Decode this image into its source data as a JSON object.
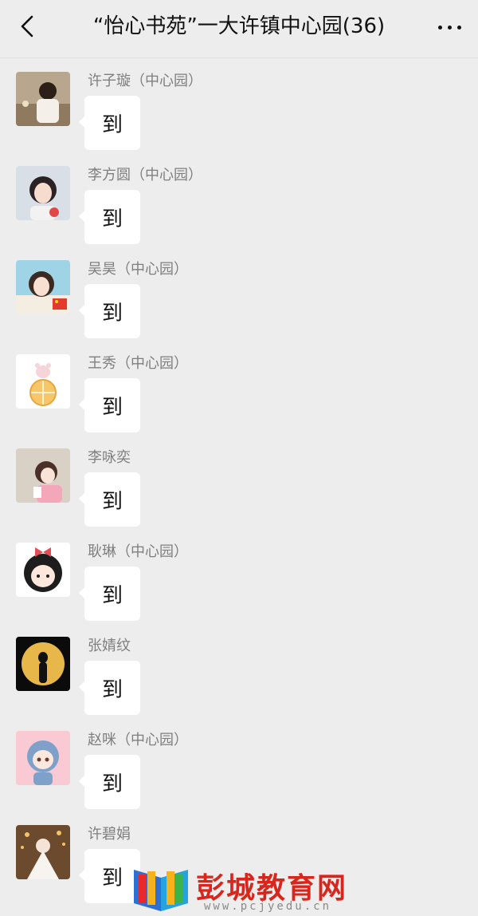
{
  "header": {
    "title": "“怡心书苑”一大许镇中心园(36)",
    "back_icon": "chevron-left-icon",
    "more_icon": "more-horizontal-icon"
  },
  "messages": [
    {
      "sender": "许子璇（中心园）",
      "text": "到"
    },
    {
      "sender": "李方圆（中心园）",
      "text": "到"
    },
    {
      "sender": "吴昊（中心园）",
      "text": "到"
    },
    {
      "sender": "王秀（中心园）",
      "text": "到"
    },
    {
      "sender": "李咏奕",
      "text": "到"
    },
    {
      "sender": "耿琳（中心园）",
      "text": "到"
    },
    {
      "sender": "张婧纹",
      "text": "到"
    },
    {
      "sender": "赵咪（中心园）",
      "text": "到"
    },
    {
      "sender": "许碧娟",
      "text": "到"
    }
  ],
  "watermark": {
    "brand": "彭城教育网",
    "url": "www.pcjyedu.cn"
  },
  "colors": {
    "background": "#ededed",
    "bubble": "#ffffff",
    "sender_text": "#7f7f7f",
    "brand_red": "#d9261c"
  }
}
